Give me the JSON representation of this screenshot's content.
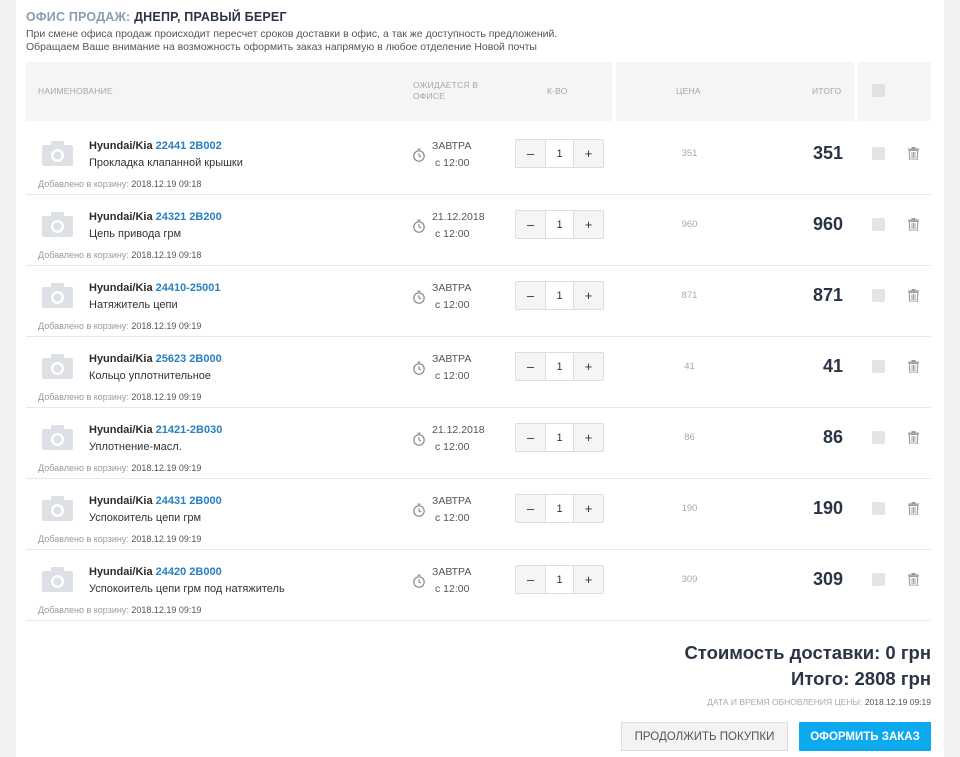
{
  "header": {
    "office_label": "ОФИС ПРОДАЖ:",
    "office_value": "ДНЕПР, ПРАВЫЙ БЕРЕГ",
    "note_line1": "При смене офиса продаж происходит пересчет сроков доставки в офис, а так же доступность предложений.",
    "note_line2": "Обращаем Ваше внимание на возможность оформить заказ напрямую в любое отделение Новой почты"
  },
  "table_headers": {
    "name": "НАИМЕНОВАНИЕ",
    "expected_line1": "ОЖИДАЕТСЯ В",
    "expected_line2": "ОФИСЕ",
    "qty": "К-ВО",
    "price": "ЦЕНА",
    "total": "ИТОГО"
  },
  "added_label": "Добавлено в корзину:",
  "items": [
    {
      "brand": "Hyundai/Kia",
      "article": "22441 2B002",
      "name": "Прокладка клапанной крышки",
      "added": "2018.12.19 09:18",
      "date": "ЗАВТРА",
      "time": "с 12:00",
      "qty": "1",
      "price": "351",
      "total": "351"
    },
    {
      "brand": "Hyundai/Kia",
      "article": "24321 2B200",
      "name": "Цепь привода грм",
      "added": "2018.12.19 09:18",
      "date": "21.12.2018",
      "time": "с 12:00",
      "qty": "1",
      "price": "960",
      "total": "960"
    },
    {
      "brand": "Hyundai/Kia",
      "article": "24410-25001",
      "name": "Натяжитель цепи",
      "added": "2018.12.19 09:19",
      "date": "ЗАВТРА",
      "time": "с 12:00",
      "qty": "1",
      "price": "871",
      "total": "871"
    },
    {
      "brand": "Hyundai/Kia",
      "article": "25623 2B000",
      "name": "Кольцо уплотнительное",
      "added": "2018.12.19 09:19",
      "date": "ЗАВТРА",
      "time": "с 12:00",
      "qty": "1",
      "price": "41",
      "total": "41"
    },
    {
      "brand": "Hyundai/Kia",
      "article": "21421-2B030",
      "name": "Уплотнение-масл.",
      "added": "2018.12.19 09:19",
      "date": "21.12.2018",
      "time": "с 12:00",
      "qty": "1",
      "price": "86",
      "total": "86"
    },
    {
      "brand": "Hyundai/Kia",
      "article": "24431 2B000",
      "name": "Успокоитель цепи грм",
      "added": "2018.12.19 09:19",
      "date": "ЗАВТРА",
      "time": "с 12:00",
      "qty": "1",
      "price": "190",
      "total": "190"
    },
    {
      "brand": "Hyundai/Kia",
      "article": "24420 2B000",
      "name": "Успокоитель цепи грм под натяжитель",
      "added": "2018.12.19 09:19",
      "date": "ЗАВТРА",
      "time": "с 12:00",
      "qty": "1",
      "price": "309",
      "total": "309"
    }
  ],
  "qty_minus": "–",
  "qty_plus": "+",
  "summary": {
    "delivery": "Стоимость доставки: 0 грн",
    "total": "Итого: 2808 грн",
    "updated_label": "ДАТА И ВРЕМЯ ОБНОВЛЕНИЯ ЦЕНЫ:",
    "updated_value": "2018.12.19 09:19"
  },
  "buttons": {
    "continue": "ПРОДОЛЖИТЬ ПОКУПКИ",
    "order": "ОФОРМИТЬ ЗАКАЗ"
  },
  "colors": {
    "accent": "#0da9ef",
    "link": "#2a7fc0",
    "heading_dark": "#2b3445"
  },
  "icons": {
    "product_photo": "camera-icon",
    "delivery_time": "clock-icon",
    "remove": "trash-icon"
  }
}
